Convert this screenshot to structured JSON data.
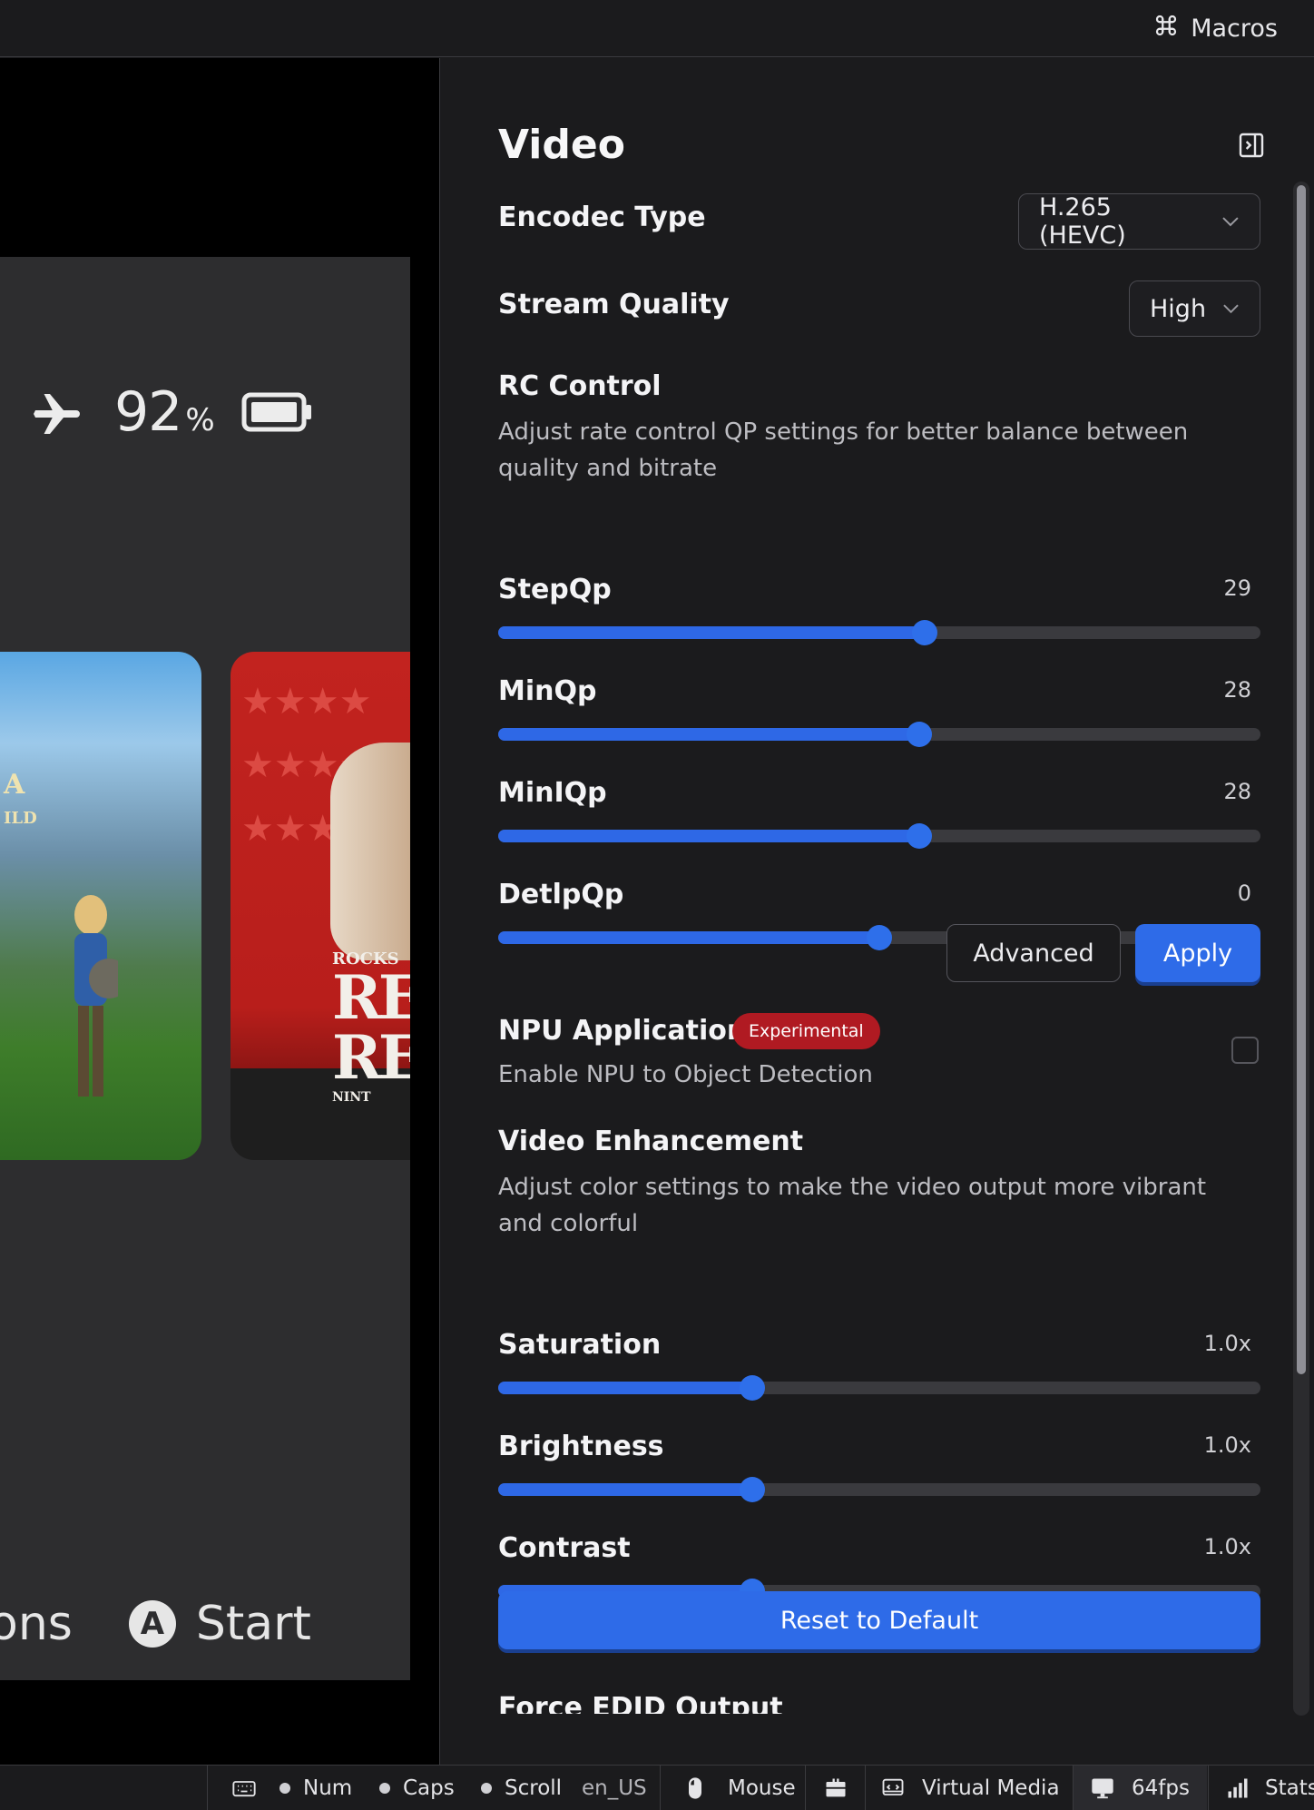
{
  "topbar": {
    "macros_label": "Macros",
    "macros_icon": "command-icon"
  },
  "stream": {
    "battery_percent": "92",
    "percent_sign": "%",
    "card1_title": "A",
    "card1_sub": "ILD",
    "card2_line1": "ROCKS",
    "card2_line2": "RE",
    "card2_line3": "REI",
    "card2_line4": "NINT",
    "hint_options": "ons",
    "hint_a_button": "A",
    "hint_start": "Start"
  },
  "panel": {
    "title": "Video",
    "encodec": {
      "label": "Encodec Type",
      "value": "H.265 (HEVC)"
    },
    "stream_quality": {
      "label": "Stream Quality",
      "value": "High"
    },
    "rc_control": {
      "label": "RC Control",
      "description": "Adjust rate control QP settings for better balance between quality and bitrate"
    },
    "sliders_rc": [
      {
        "label": "StepQp",
        "value": "29",
        "fraction": 0.56
      },
      {
        "label": "MinQp",
        "value": "28",
        "fraction": 0.552
      },
      {
        "label": "MinIQp",
        "value": "28",
        "fraction": 0.552
      },
      {
        "label": "DetlpQp",
        "value": "0",
        "fraction": 0.5
      }
    ],
    "advanced_label": "Advanced",
    "apply_label": "Apply",
    "npu": {
      "label": "NPU Application",
      "badge": "Experimental",
      "description": "Enable NPU to Object Detection",
      "checked": false
    },
    "video_enhancement": {
      "label": "Video Enhancement",
      "description": "Adjust color settings to make the video output more vibrant and colorful"
    },
    "sliders_ve": [
      {
        "label": "Saturation",
        "value": "1.0x",
        "fraction": 0.333
      },
      {
        "label": "Brightness",
        "value": "1.0x",
        "fraction": 0.333
      },
      {
        "label": "Contrast",
        "value": "1.0x",
        "fraction": 0.333
      }
    ],
    "reset_label": "Reset to Default",
    "next_section_label": "Force EDID Output"
  },
  "footer": {
    "num": "Num",
    "caps": "Caps",
    "scroll": "Scroll",
    "locale": "en_US",
    "mouse": "Mouse",
    "virtual_media": "Virtual Media",
    "fps": "64fps",
    "stats": "Stats"
  },
  "colors": {
    "accent": "#2e6be8",
    "badge": "#b01a22",
    "background": "#1b1b1d"
  }
}
